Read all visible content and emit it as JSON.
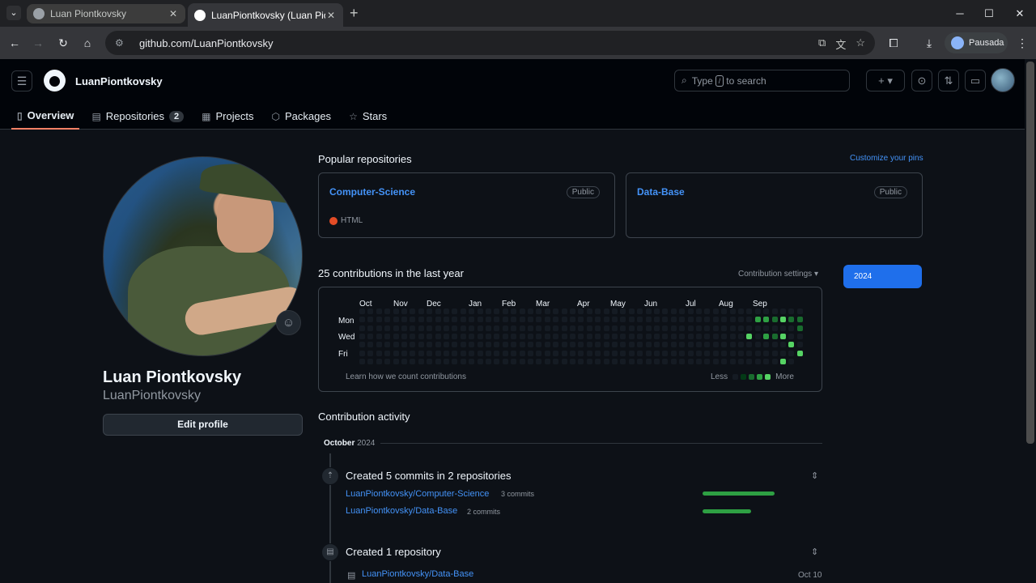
{
  "browser": {
    "tabs": [
      {
        "title": "Luan Piontkovsky",
        "state": "inactive"
      },
      {
        "title": "LuanPiontkovsky (Luan Piontko",
        "state": "active"
      }
    ],
    "url": "github.com/LuanPiontkovsky",
    "profile_label": "Pausada"
  },
  "header": {
    "username": "LuanPiontkovsky",
    "search_prefix": "Type",
    "search_key": "/",
    "search_suffix": "to search",
    "tabs": [
      {
        "label": "Overview",
        "icon": "book-icon",
        "selected": true
      },
      {
        "label": "Repositories",
        "icon": "repo-icon",
        "count": "2"
      },
      {
        "label": "Projects",
        "icon": "table-icon"
      },
      {
        "label": "Packages",
        "icon": "package-icon"
      },
      {
        "label": "Stars",
        "icon": "star-icon"
      }
    ]
  },
  "profile": {
    "full_name": "Luan Piontkovsky",
    "login": "LuanPiontkovsky",
    "edit_button": "Edit profile"
  },
  "popular": {
    "title": "Popular repositories",
    "customize": "Customize your pins",
    "repos": [
      {
        "name": "Computer-Science",
        "visibility": "Public",
        "language": "HTML",
        "language_color": "#e34c26"
      },
      {
        "name": "Data-Base",
        "visibility": "Public",
        "language": "",
        "language_color": ""
      }
    ]
  },
  "contributions": {
    "title": "25 contributions in the last year",
    "settings": "Contribution settings ▾",
    "year": "2024",
    "months": [
      "Oct",
      "Nov",
      "Dec",
      "Jan",
      "Feb",
      "Mar",
      "Apr",
      "May",
      "Jun",
      "Jul",
      "Aug",
      "Sep"
    ],
    "days": [
      "Mon",
      "Wed",
      "Fri"
    ],
    "learn": "Learn how we count contributions",
    "less": "Less",
    "more": "More",
    "level_colors": [
      "#151b23",
      "#033a16",
      "#196c2e",
      "#2ea043",
      "#56d364"
    ]
  },
  "activity": {
    "title": "Contribution activity",
    "month": "October",
    "year": "2024",
    "commits_heading": "Created 5 commits in 2 repositories",
    "commit_repos": [
      {
        "name": "LuanPiontkovsky/Computer-Science",
        "count": "3 commits",
        "fraction": 0.6
      },
      {
        "name": "LuanPiontkovsky/Data-Base",
        "count": "2 commits",
        "fraction": 0.4
      }
    ],
    "created_heading": "Created 1 repository",
    "created_repo": "LuanPiontkovsky/Data-Base",
    "created_date": "Oct 10"
  }
}
